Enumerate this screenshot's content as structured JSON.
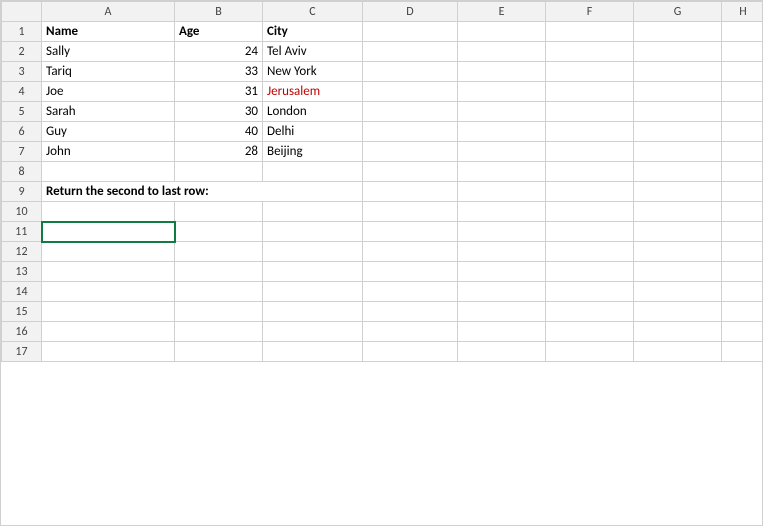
{
  "columns": [
    "",
    "A",
    "B",
    "C",
    "D",
    "E",
    "F",
    "G",
    "H"
  ],
  "rows": [
    {
      "rowNum": 1,
      "cells": [
        {
          "val": "Name",
          "cls": "bold-text"
        },
        {
          "val": "Age",
          "cls": "bold-text"
        },
        {
          "val": "City",
          "cls": "bold-text"
        },
        "",
        "",
        "",
        "",
        ""
      ]
    },
    {
      "rowNum": 2,
      "cells": [
        {
          "val": "Sally"
        },
        {
          "val": "24",
          "cls": "num"
        },
        {
          "val": "Tel Aviv"
        },
        "",
        "",
        "",
        "",
        ""
      ]
    },
    {
      "rowNum": 3,
      "cells": [
        {
          "val": "Tariq"
        },
        {
          "val": "33",
          "cls": "num"
        },
        {
          "val": "New York"
        },
        "",
        "",
        "",
        "",
        ""
      ]
    },
    {
      "rowNum": 4,
      "cells": [
        {
          "val": "Joe"
        },
        {
          "val": "31",
          "cls": "num"
        },
        {
          "val": "Jerusalem",
          "cls": "city-red"
        },
        "",
        "",
        "",
        "",
        ""
      ]
    },
    {
      "rowNum": 5,
      "cells": [
        {
          "val": "Sarah"
        },
        {
          "val": "30",
          "cls": "num"
        },
        {
          "val": "London"
        },
        "",
        "",
        "",
        "",
        ""
      ]
    },
    {
      "rowNum": 6,
      "cells": [
        {
          "val": "Guy"
        },
        {
          "val": "40",
          "cls": "num"
        },
        {
          "val": "Delhi"
        },
        "",
        "",
        "",
        "",
        ""
      ]
    },
    {
      "rowNum": 7,
      "cells": [
        {
          "val": "John"
        },
        {
          "val": "28",
          "cls": "num"
        },
        {
          "val": "Beijing"
        },
        "",
        "",
        "",
        "",
        ""
      ]
    },
    {
      "rowNum": 8,
      "cells": [
        "",
        "",
        "",
        "",
        "",
        "",
        "",
        ""
      ]
    },
    {
      "rowNum": 9,
      "cells": [
        {
          "val": "Return the second to last row:",
          "cls": "bold-text",
          "colspan": 3
        },
        "",
        "",
        "",
        "",
        "",
        ""
      ]
    },
    {
      "rowNum": 10,
      "cells": [
        "",
        "",
        "",
        "",
        "",
        "",
        "",
        ""
      ]
    },
    {
      "rowNum": 11,
      "cells": [
        {
          "val": "",
          "cls": "active"
        },
        "",
        "",
        "",
        "",
        "",
        "",
        ""
      ]
    },
    {
      "rowNum": 12,
      "cells": [
        "",
        "",
        "",
        "",
        "",
        "",
        "",
        ""
      ]
    },
    {
      "rowNum": 13,
      "cells": [
        "",
        "",
        "",
        "",
        "",
        "",
        "",
        ""
      ]
    },
    {
      "rowNum": 14,
      "cells": [
        "",
        "",
        "",
        "",
        "",
        "",
        "",
        ""
      ]
    },
    {
      "rowNum": 15,
      "cells": [
        "",
        "",
        "",
        "",
        "",
        "",
        "",
        ""
      ]
    },
    {
      "rowNum": 16,
      "cells": [
        "",
        "",
        "",
        "",
        "",
        "",
        "",
        ""
      ]
    },
    {
      "rowNum": 17,
      "cells": [
        "",
        "",
        "",
        "",
        "",
        "",
        "",
        ""
      ]
    }
  ]
}
